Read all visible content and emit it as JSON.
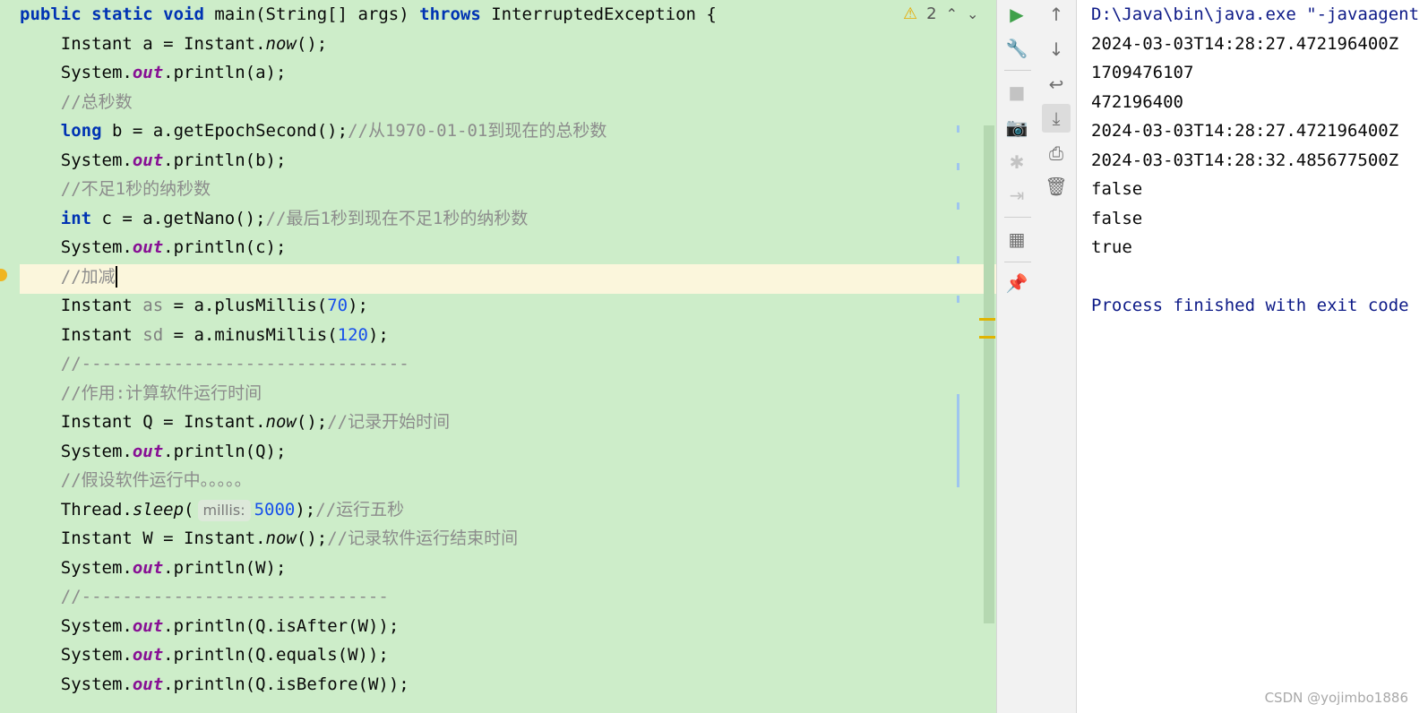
{
  "editor": {
    "inspection_count": "2",
    "lines": [
      {
        "segments": [
          {
            "t": "public static void ",
            "c": "kw"
          },
          {
            "t": "main(String[] args) ",
            "c": "ty"
          },
          {
            "t": "throws ",
            "c": "kw"
          },
          {
            "t": "InterruptedException {",
            "c": "ty"
          }
        ]
      },
      {
        "segments": [
          {
            "t": "    Instant a = Instant.",
            "c": "ty"
          },
          {
            "t": "now",
            "c": "st"
          },
          {
            "t": "();",
            "c": "ty"
          }
        ]
      },
      {
        "segments": [
          {
            "t": "    System.",
            "c": "ty"
          },
          {
            "t": "out",
            "c": "fld"
          },
          {
            "t": ".println(a);",
            "c": "ty"
          }
        ]
      },
      {
        "segments": [
          {
            "t": "    //总秒数",
            "c": "cm"
          }
        ]
      },
      {
        "segments": [
          {
            "t": "    ",
            "c": "ty"
          },
          {
            "t": "long ",
            "c": "kw"
          },
          {
            "t": "b = a.getEpochSecond();",
            "c": "ty"
          },
          {
            "t": "//从1970-01-01到现在的总秒数",
            "c": "cm"
          }
        ]
      },
      {
        "segments": [
          {
            "t": "    System.",
            "c": "ty"
          },
          {
            "t": "out",
            "c": "fld"
          },
          {
            "t": ".println(b);",
            "c": "ty"
          }
        ]
      },
      {
        "segments": [
          {
            "t": "    //不足1秒的纳秒数",
            "c": "cm"
          }
        ]
      },
      {
        "segments": [
          {
            "t": "    ",
            "c": "ty"
          },
          {
            "t": "int ",
            "c": "kw"
          },
          {
            "t": "c = a.getNano();",
            "c": "ty"
          },
          {
            "t": "//最后1秒到现在不足1秒的纳秒数",
            "c": "cm"
          }
        ]
      },
      {
        "segments": [
          {
            "t": "    System.",
            "c": "ty"
          },
          {
            "t": "out",
            "c": "fld"
          },
          {
            "t": ".println(c);",
            "c": "ty"
          }
        ]
      },
      {
        "segments": [
          {
            "t": "    //加减",
            "c": "cm"
          }
        ],
        "caret": true
      },
      {
        "segments": [
          {
            "t": "    Instant ",
            "c": "ty"
          },
          {
            "t": "as",
            "c": "unused"
          },
          {
            "t": " = a.plusMillis(",
            "c": "ty"
          },
          {
            "t": "70",
            "c": "num"
          },
          {
            "t": ");",
            "c": "ty"
          }
        ]
      },
      {
        "segments": [
          {
            "t": "    Instant ",
            "c": "ty"
          },
          {
            "t": "sd",
            "c": "unused"
          },
          {
            "t": " = a.minusMillis(",
            "c": "ty"
          },
          {
            "t": "120",
            "c": "num"
          },
          {
            "t": ");",
            "c": "ty"
          }
        ]
      },
      {
        "segments": [
          {
            "t": "    //--------------------------------",
            "c": "cm"
          }
        ]
      },
      {
        "segments": [
          {
            "t": "    //作用:计算软件运行时间",
            "c": "cm"
          }
        ]
      },
      {
        "segments": [
          {
            "t": "    Instant Q = Instant.",
            "c": "ty"
          },
          {
            "t": "now",
            "c": "st"
          },
          {
            "t": "();",
            "c": "ty"
          },
          {
            "t": "//记录开始时间",
            "c": "cm"
          }
        ]
      },
      {
        "segments": [
          {
            "t": "    System.",
            "c": "ty"
          },
          {
            "t": "out",
            "c": "fld"
          },
          {
            "t": ".println(Q);",
            "c": "ty"
          }
        ]
      },
      {
        "segments": [
          {
            "t": "    //假设软件运行中。。。。。",
            "c": "cm"
          }
        ]
      },
      {
        "segments": [
          {
            "t": "    Thread.",
            "c": "ty"
          },
          {
            "t": "sleep",
            "c": "st"
          },
          {
            "t": "(",
            "c": "ty"
          },
          {
            "t": "millis:",
            "c": "hint"
          },
          {
            "t": "5000",
            "c": "num"
          },
          {
            "t": ");",
            "c": "ty"
          },
          {
            "t": "//运行五秒",
            "c": "cm"
          }
        ]
      },
      {
        "segments": [
          {
            "t": "    Instant W = Instant.",
            "c": "ty"
          },
          {
            "t": "now",
            "c": "st"
          },
          {
            "t": "();",
            "c": "ty"
          },
          {
            "t": "//记录软件运行结束时间",
            "c": "cm"
          }
        ]
      },
      {
        "segments": [
          {
            "t": "    System.",
            "c": "ty"
          },
          {
            "t": "out",
            "c": "fld"
          },
          {
            "t": ".println(W);",
            "c": "ty"
          }
        ]
      },
      {
        "segments": [
          {
            "t": "    //------------------------------",
            "c": "cm"
          }
        ]
      },
      {
        "segments": [
          {
            "t": "    System.",
            "c": "ty"
          },
          {
            "t": "out",
            "c": "fld"
          },
          {
            "t": ".println(Q.isAfter(W));",
            "c": "ty"
          }
        ]
      },
      {
        "segments": [
          {
            "t": "    System.",
            "c": "ty"
          },
          {
            "t": "out",
            "c": "fld"
          },
          {
            "t": ".println(Q.equals(W));",
            "c": "ty"
          }
        ]
      },
      {
        "segments": [
          {
            "t": "    System.",
            "c": "ty"
          },
          {
            "t": "out",
            "c": "fld"
          },
          {
            "t": ".println(Q.isBefore(W));",
            "c": "ty"
          }
        ]
      }
    ]
  },
  "run_toolbar": {
    "buttons": [
      {
        "name": "rerun-icon",
        "glyph": "▶",
        "state": "run"
      },
      {
        "name": "wrench-icon",
        "glyph": "🔧",
        "state": "normal"
      },
      {
        "name": "stop-icon",
        "glyph": "■",
        "state": "disabled"
      },
      {
        "name": "camera-icon",
        "glyph": "📷",
        "state": "disabled"
      },
      {
        "name": "debug-bug-icon",
        "glyph": "✱",
        "state": "disabled"
      },
      {
        "name": "exit-icon",
        "glyph": "⇥",
        "state": "disabled"
      },
      {
        "name": "layout-icon",
        "glyph": "▦",
        "state": "normal"
      },
      {
        "name": "pin-icon",
        "glyph": "📌",
        "state": "normal"
      }
    ]
  },
  "console_toolbar": {
    "buttons": [
      {
        "name": "scroll-up-icon",
        "glyph": "↑",
        "state": "normal"
      },
      {
        "name": "scroll-down-icon",
        "glyph": "↓",
        "state": "normal"
      },
      {
        "name": "soft-wrap-icon",
        "glyph": "↩",
        "state": "normal"
      },
      {
        "name": "scroll-to-end-icon",
        "glyph": "⤓",
        "state": "active"
      },
      {
        "name": "print-icon",
        "glyph": "⎙",
        "state": "normal"
      },
      {
        "name": "trash-icon",
        "glyph": "🗑",
        "state": "normal"
      }
    ]
  },
  "console": {
    "lines": [
      {
        "text": "D:\\Java\\bin\\java.exe \"-javaagent",
        "kind": "sys"
      },
      {
        "text": "2024-03-03T14:28:27.472196400Z",
        "kind": "out"
      },
      {
        "text": "1709476107",
        "kind": "out"
      },
      {
        "text": "472196400",
        "kind": "out"
      },
      {
        "text": "2024-03-03T14:28:27.472196400Z",
        "kind": "out"
      },
      {
        "text": "2024-03-03T14:28:32.485677500Z",
        "kind": "out"
      },
      {
        "text": "false",
        "kind": "out"
      },
      {
        "text": "false",
        "kind": "out"
      },
      {
        "text": "true",
        "kind": "out"
      },
      {
        "text": "",
        "kind": "out"
      },
      {
        "text": "Process finished with exit code",
        "kind": "sys"
      }
    ]
  },
  "watermark": "CSDN @yojimbo1886"
}
